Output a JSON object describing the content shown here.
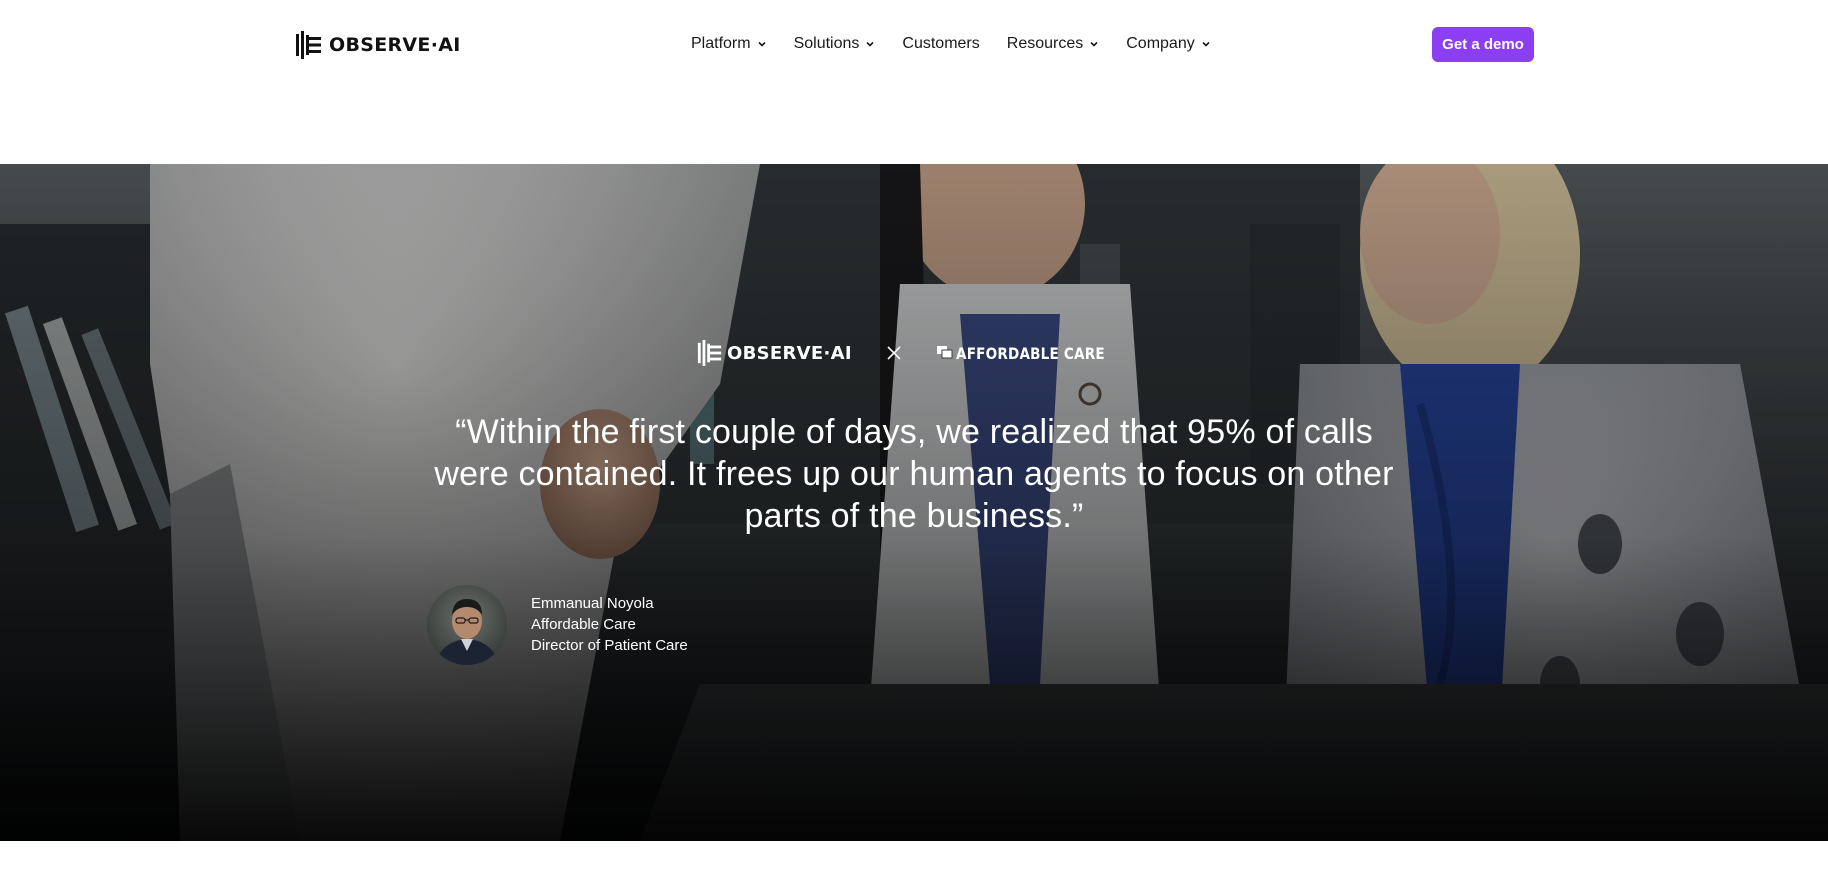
{
  "header": {
    "logo_text": "OBSERVE·AI",
    "nav": [
      {
        "label": "Platform",
        "has_dropdown": true
      },
      {
        "label": "Solutions",
        "has_dropdown": true
      },
      {
        "label": "Customers",
        "has_dropdown": false
      },
      {
        "label": "Resources",
        "has_dropdown": true
      },
      {
        "label": "Company",
        "has_dropdown": true
      }
    ],
    "cta_label": "Get a demo",
    "cta_color": "#8b3ef2"
  },
  "hero": {
    "partner_logo_left": "OBSERVE·AI",
    "separator_icon": "close-icon",
    "partner_logo_right": "AFFORDABLE CARE",
    "quote": "“Within the first couple of days, we realized that 95% of calls were contained. It frees up our human agents to focus on other parts of the business.”",
    "author": {
      "name": "Emmanual Noyola",
      "company": "Affordable Care",
      "title": "Director of Patient Care"
    }
  },
  "icons": {
    "brand_mark": "observe-ai-logo-mark",
    "dropdown": "chevron-down-icon"
  }
}
